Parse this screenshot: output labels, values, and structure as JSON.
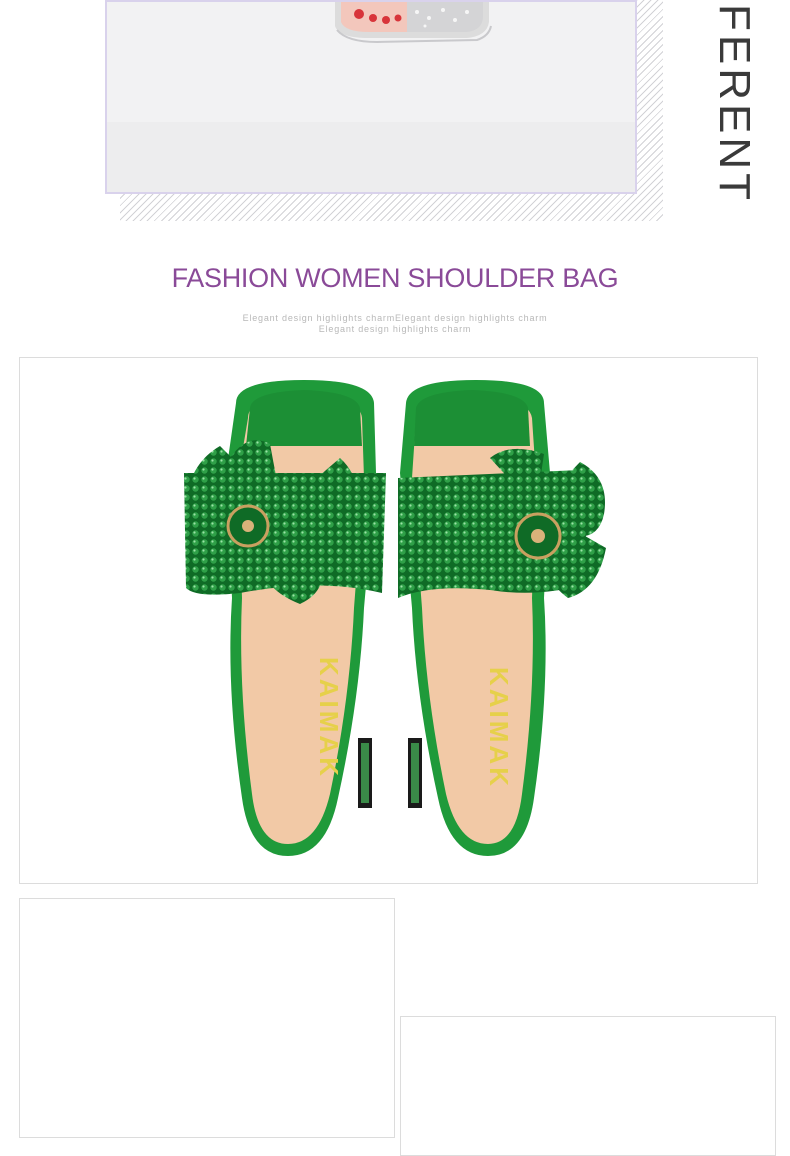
{
  "top_section": {
    "vertical_word": "FERENT",
    "image_alt": "silver sandal photo (top, cropped)"
  },
  "heading": {
    "title": "FASHION WOMEN SHOULDER BAG",
    "subtitle_line1": "Elegant design highlights charmElegant design highlights charm",
    "subtitle_line2": "Elegant design highlights charm"
  },
  "main_photo": {
    "alt": "green rhinestone bow slide sandals",
    "insole_brand": "KAIMAK"
  },
  "colors": {
    "heading": "#8a4a98",
    "sandal_green": "#1f9a3a",
    "insole": "#f2c9a6"
  }
}
